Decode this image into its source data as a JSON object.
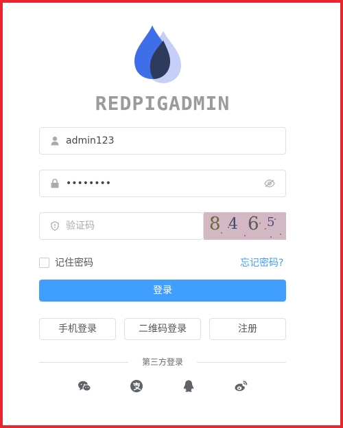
{
  "brand": {
    "name": "REDPIGADMIN"
  },
  "form": {
    "username": {
      "value": "admin123",
      "placeholder": ""
    },
    "password": {
      "value": "12345678",
      "placeholder": ""
    },
    "captcha": {
      "value": "",
      "placeholder": "验证码",
      "image_text": [
        "8",
        "4",
        "6",
        "5"
      ]
    },
    "remember_label": "记住密码",
    "remember_checked": false,
    "forgot_label": "忘记密码?",
    "login_label": "登录"
  },
  "alt_actions": {
    "phone_login": "手机登录",
    "qrcode_login": "二维码登录",
    "register": "注册"
  },
  "third_party": {
    "label": "第三方登录",
    "icons": [
      "wechat-icon",
      "alipay-icon",
      "qq-icon",
      "weibo-icon"
    ]
  },
  "colors": {
    "primary": "#409eff",
    "frame_border": "#e8262e",
    "logo_blue": "#3f6fe8",
    "logo_light": "#c5cff8",
    "logo_dark": "#2e3a5c"
  }
}
